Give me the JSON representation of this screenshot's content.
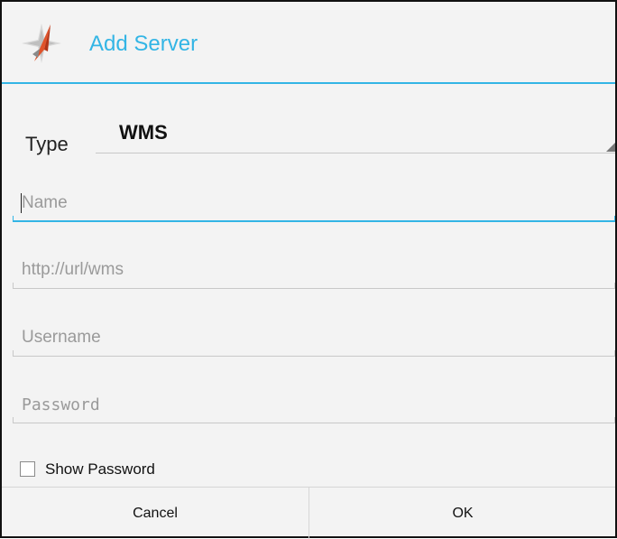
{
  "dialog": {
    "title": "Add Server",
    "icon": "app-compass-icon",
    "accent_color": "#33b5e5"
  },
  "type_row": {
    "label": "Type",
    "selected": "WMS"
  },
  "fields": {
    "name": {
      "placeholder": "Name",
      "value": ""
    },
    "url": {
      "placeholder": "http://url/wms",
      "value": ""
    },
    "username": {
      "placeholder": "Username",
      "value": ""
    },
    "password": {
      "placeholder": "Password",
      "value": ""
    }
  },
  "show_password": {
    "label": "Show Password",
    "checked": false
  },
  "buttons": {
    "cancel": "Cancel",
    "ok": "OK"
  }
}
